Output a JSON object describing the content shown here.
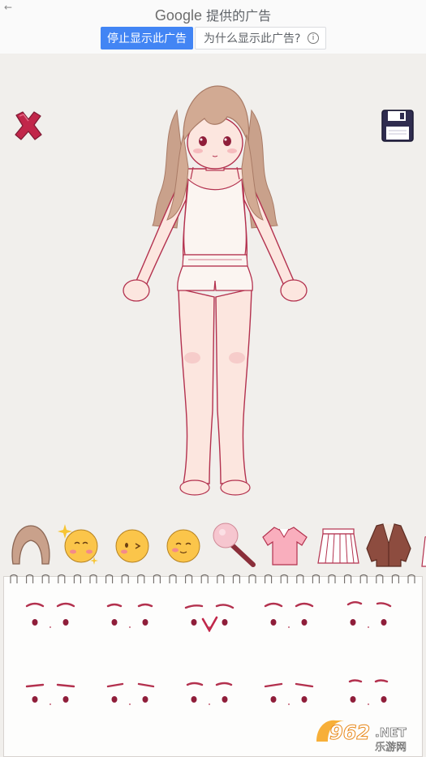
{
  "ad_bar": {
    "back_glyph": "←",
    "brand": "Google",
    "provided_text": "提供的广告",
    "stop_button": "停止显示此广告",
    "why_button": "为什么显示此广告?",
    "info_glyph": "i"
  },
  "toolbar": {
    "close_icon": "close-x-icon",
    "save_icon": "floppy-disk-icon"
  },
  "categories": [
    {
      "name": "hair",
      "icon": "hair-icon"
    },
    {
      "name": "face-expression",
      "icon": "sparkle-face-icon"
    },
    {
      "name": "face-wink",
      "icon": "wink-face-icon"
    },
    {
      "name": "face-smile",
      "icon": "smile-face-icon"
    },
    {
      "name": "blush-brush",
      "icon": "makeup-brush-icon"
    },
    {
      "name": "top",
      "icon": "polo-shirt-icon"
    },
    {
      "name": "skirt",
      "icon": "pleated-skirt-icon"
    },
    {
      "name": "jacket",
      "icon": "jacket-icon"
    }
  ],
  "eye_options_count": 10,
  "watermark": {
    "number": "962",
    "suffix": ".NET",
    "sub": "乐游网"
  },
  "colors": {
    "background": "#f1efec",
    "accent_red": "#c1274a",
    "ad_blue": "#4285f4",
    "outline": "#b3314e"
  }
}
